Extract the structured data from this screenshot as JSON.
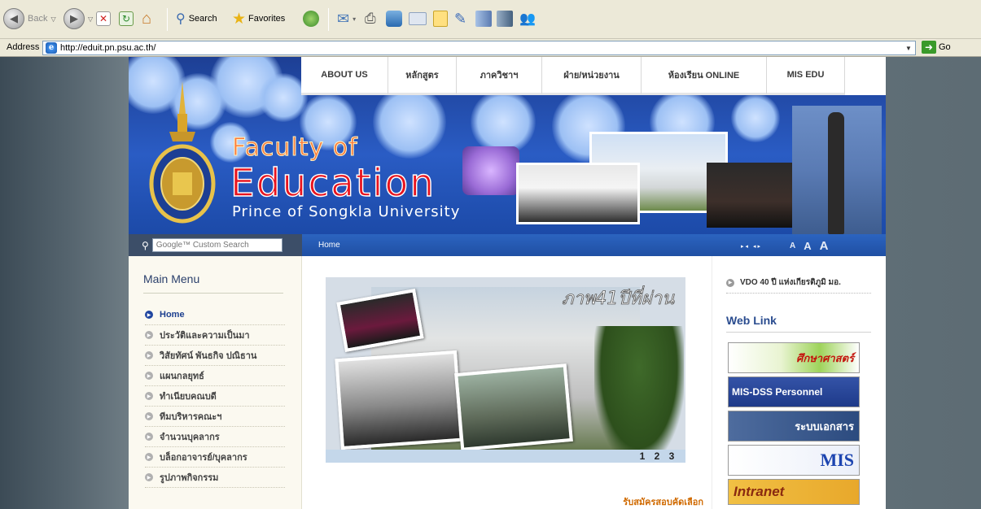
{
  "browser": {
    "toolbar": {
      "back_label": "Back",
      "search_label": "Search",
      "favorites_label": "Favorites"
    },
    "address": {
      "label": "Address",
      "url": "http://eduit.pn.psu.ac.th/",
      "go_label": "Go"
    }
  },
  "site": {
    "nav": [
      "ABOUT US",
      "หลักสูตร",
      "ภาควิชาฯ",
      "ฝ่าย/หน่วยงาน",
      "ห้องเรียน ONLINE",
      "MIS EDU"
    ],
    "header": {
      "line1": "Faculty of",
      "line2": "Education",
      "line3": "Prince of Songkla University"
    },
    "search": {
      "placeholder": "Google™ Custom Search"
    },
    "breadcrumb": "Home",
    "text_size": {
      "arrows": "▸◂ ◂▸",
      "small": "A",
      "medium": "A",
      "large": "A"
    },
    "sidebar": {
      "title": "Main Menu",
      "items": [
        "Home",
        "ประวัติและความเป็นมา",
        "วิสัยทัศน์ พันธกิจ ปณิธาน",
        "แผนกลยุทธ์",
        "ทำเนียบคณบดี",
        "ทีมบริหารคณะฯ",
        "จำนวนบุคลากร",
        "บล็อกอาจารย์/บุคลากร",
        "รูปภาพกิจกรรม"
      ]
    },
    "slideshow": {
      "caption": "ภาพ41ปีที่ผ่าน",
      "pages": [
        "1",
        "2",
        "3"
      ]
    },
    "register_link": "รับสมัครสอบคัดเลือก",
    "right": {
      "vdo_link": "VDO 40 ปี แห่งเกียรติภูมิ มอ.",
      "weblink_title": "Web Link",
      "banners": [
        "ศึกษาศาสตร์",
        "MIS-DSS Personnel",
        "ระบบเอกสาร",
        "MIS",
        "Intranet"
      ]
    }
  },
  "colors": {
    "header_blue": "#2a5cc4",
    "nav_text": "#3a3a3a",
    "active_menu": "#1c3f8f",
    "register_orange": "#d06a00"
  }
}
